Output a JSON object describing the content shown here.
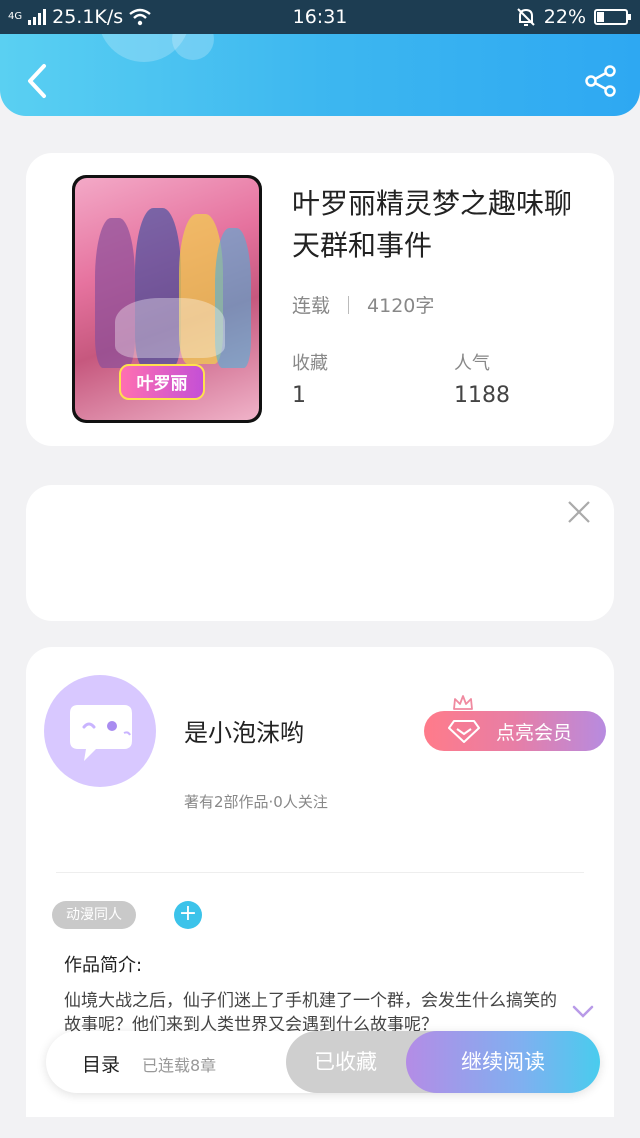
{
  "status_bar": {
    "network": "4G",
    "speed": "25.1K/s",
    "time": "16:31",
    "battery": "22%"
  },
  "header": {
    "gradient_start": "#5ad0f2",
    "gradient_end": "#2ea8f2",
    "back_icon": "chevron-left-icon",
    "share_icon": "share-icon"
  },
  "book": {
    "title": "叶罗丽精灵梦之趣味聊天群和事件",
    "status": "连载",
    "word_count": "4120字",
    "favorites_label": "收藏",
    "favorites_value": "1",
    "popularity_label": "人气",
    "popularity_value": "1188",
    "cover_logo": "叶罗丽"
  },
  "ad": {
    "close_icon": "close-icon"
  },
  "author": {
    "name": "是小泡沫哟",
    "stats": "著有2部作品·0人关注",
    "vip_button": "点亮会员",
    "tag": "动漫同人",
    "add_tag": "+",
    "intro_label": "作品简介:",
    "intro_text": "仙境大战之后，仙子们迷上了手机建了一个群，会发生什么搞笑的故事呢？他们来到人类世界又会遇到什么故事呢？"
  },
  "bottom_bar": {
    "toc_label": "目录",
    "chapters": "已连载8章",
    "favorite_button": "已收藏",
    "read_button": "继续阅读",
    "accent": "#49ccee",
    "vip_accent": "#b78be0"
  }
}
